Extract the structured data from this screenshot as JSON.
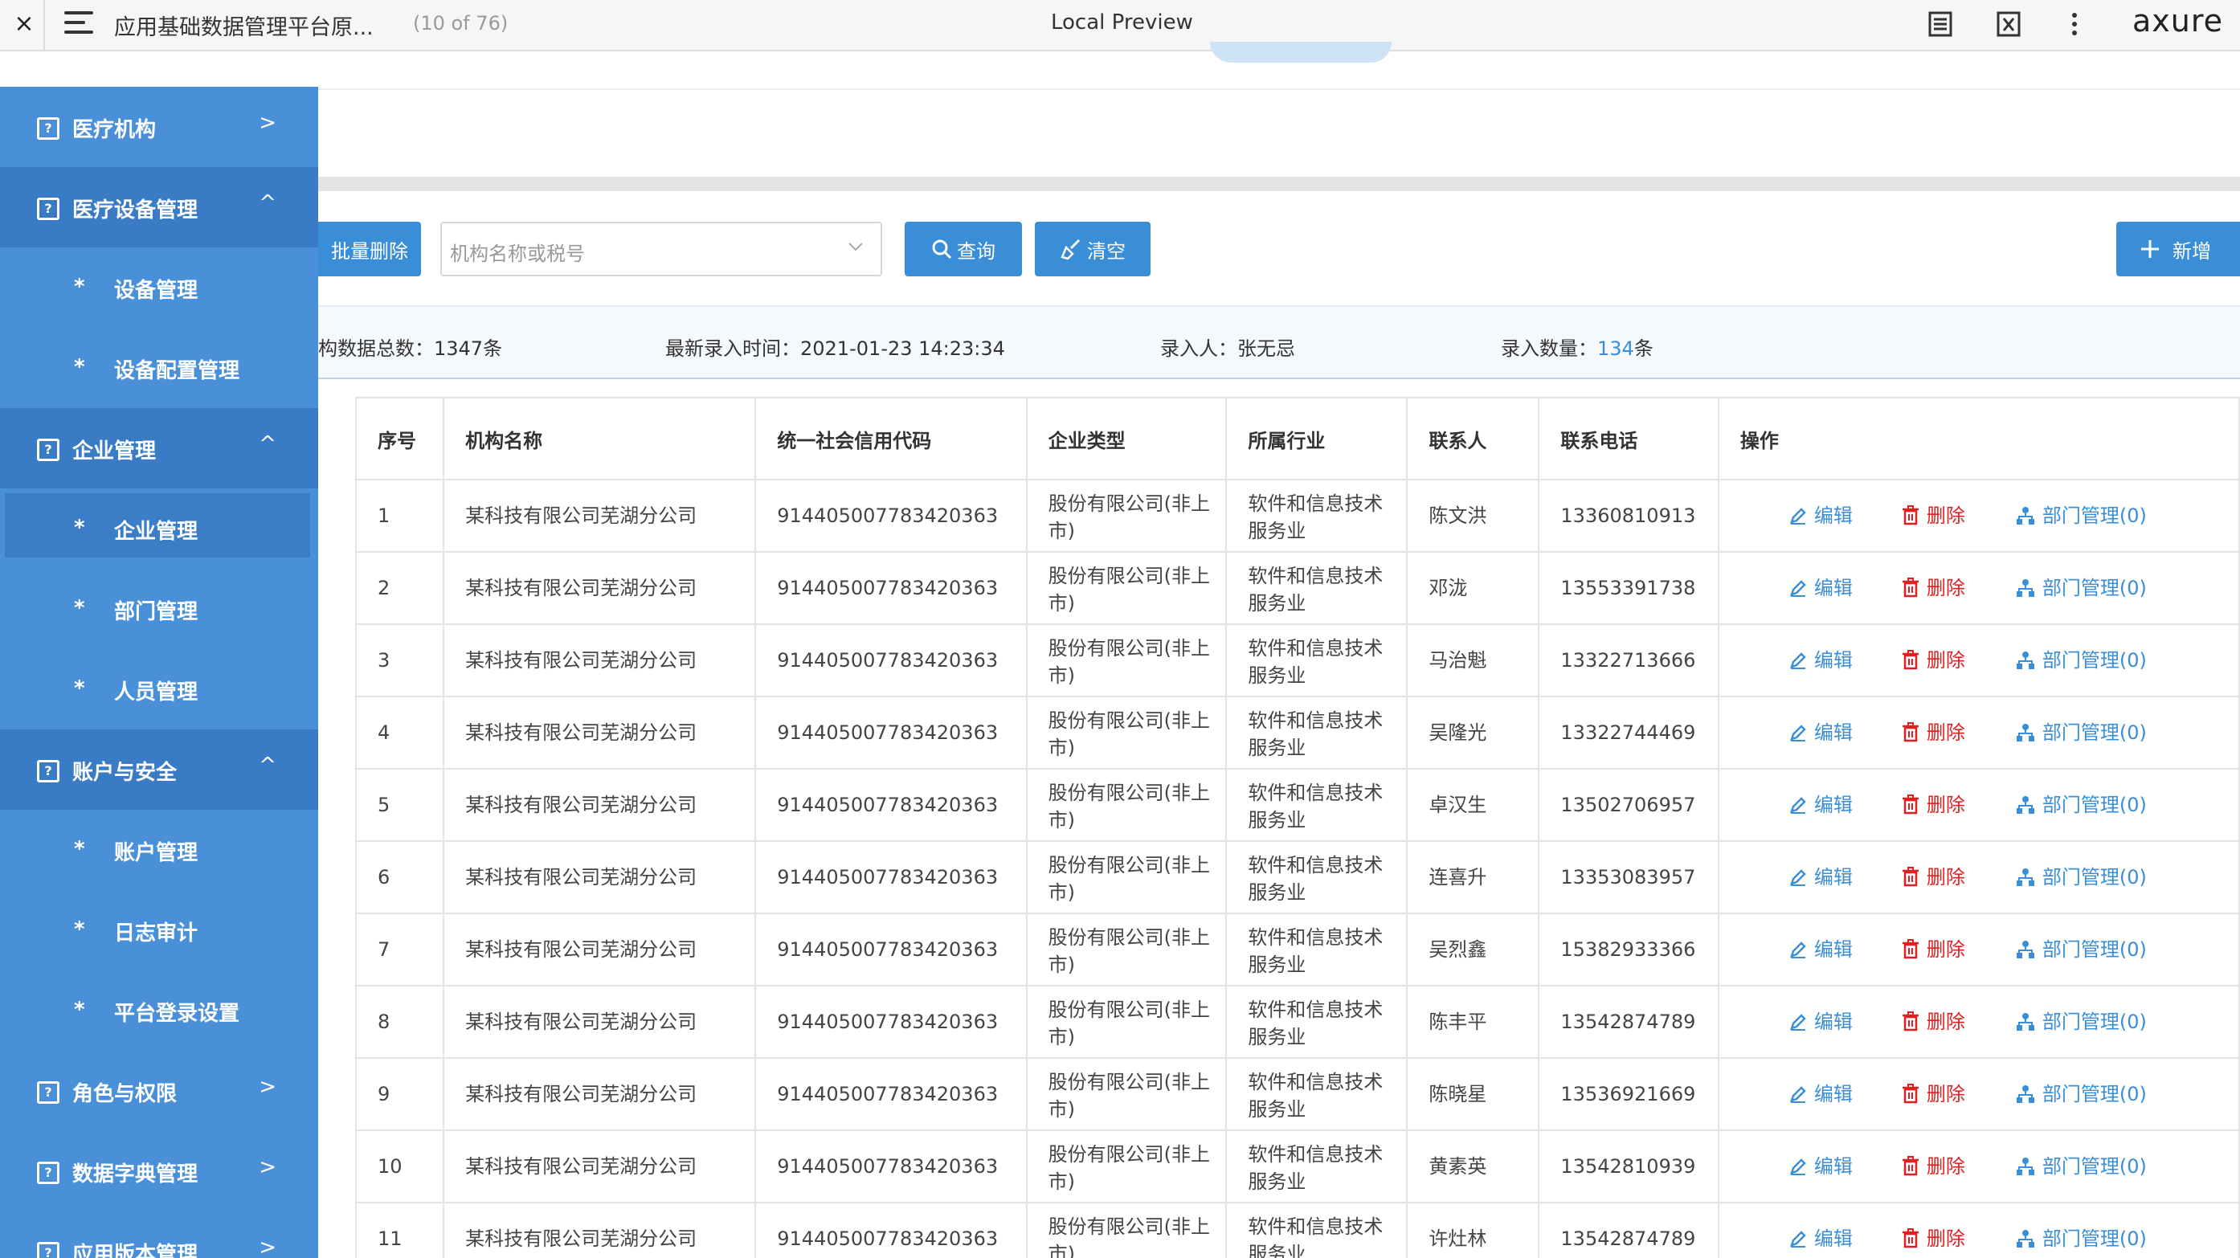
{
  "topbar": {
    "close": "×",
    "doc_title": "应用基础数据管理平台原...",
    "page_count": "(10 of 76)",
    "center_title": "Local Preview",
    "brand": "axure"
  },
  "sidebar": {
    "groups": [
      {
        "label": "医疗机构",
        "arrow": ">"
      },
      {
        "label": "医疗设备管理",
        "arrow": "^",
        "items": [
          {
            "label": "设备管理"
          },
          {
            "label": "设备配置管理"
          }
        ]
      },
      {
        "label": "企业管理",
        "arrow": "^",
        "items": [
          {
            "label": "企业管理"
          },
          {
            "label": "部门管理"
          },
          {
            "label": "人员管理"
          }
        ]
      },
      {
        "label": "账户与安全",
        "arrow": "^",
        "items": [
          {
            "label": "账户管理"
          },
          {
            "label": "日志审计"
          },
          {
            "label": "平台登录设置"
          }
        ]
      },
      {
        "label": "角色与权限",
        "arrow": ">"
      },
      {
        "label": "数据字典管理",
        "arrow": ">"
      },
      {
        "label": "应用版本管理",
        "arrow": ">"
      }
    ],
    "star": "*",
    "group_icon": "?"
  },
  "toolbar": {
    "batch_delete": "批量删除",
    "search_placeholder": "机构名称或税号",
    "query": "查询",
    "clear": "清空",
    "add": "新增"
  },
  "summary": {
    "total_label": "构数据总数：",
    "total_value": "1347条",
    "latest_label": "最新录入时间：",
    "latest_value": "2021-01-23 14:23:34",
    "entry_person_label": "录入人：",
    "entry_person_value": "张无忌",
    "entry_count_label": "录入数量：",
    "entry_count_value": "134",
    "entry_count_unit": "条"
  },
  "table": {
    "headers": [
      "序号",
      "机构名称",
      "统一社会信用代码",
      "企业类型",
      "所属行业",
      "联系人",
      "联系电话",
      "操作"
    ],
    "actions": {
      "edit": "编辑",
      "delete": "删除",
      "dept": "部门管理(0)"
    },
    "rows": [
      {
        "no": "1",
        "name": "某科技有限公司芜湖分公司",
        "code": "914405007783420363",
        "type1": "股份有限公司(非上",
        "type2": "市)",
        "ind1": "软件和信息技术",
        "ind2": "服务业",
        "contact": "陈文洪",
        "phone": "13360810913"
      },
      {
        "no": "2",
        "name": "某科技有限公司芜湖分公司",
        "code": "914405007783420363",
        "type1": "股份有限公司(非上",
        "type2": "市)",
        "ind1": "软件和信息技术",
        "ind2": "服务业",
        "contact": "邓泷",
        "phone": "13553391738"
      },
      {
        "no": "3",
        "name": "某科技有限公司芜湖分公司",
        "code": "914405007783420363",
        "type1": "股份有限公司(非上",
        "type2": "市)",
        "ind1": "软件和信息技术",
        "ind2": "服务业",
        "contact": "马治魁",
        "phone": "13322713666"
      },
      {
        "no": "4",
        "name": "某科技有限公司芜湖分公司",
        "code": "914405007783420363",
        "type1": "股份有限公司(非上",
        "type2": "市)",
        "ind1": "软件和信息技术",
        "ind2": "服务业",
        "contact": "吴隆光",
        "phone": "13322744469"
      },
      {
        "no": "5",
        "name": "某科技有限公司芜湖分公司",
        "code": "914405007783420363",
        "type1": "股份有限公司(非上",
        "type2": "市)",
        "ind1": "软件和信息技术",
        "ind2": "服务业",
        "contact": "卓汉生",
        "phone": "13502706957"
      },
      {
        "no": "6",
        "name": "某科技有限公司芜湖分公司",
        "code": "914405007783420363",
        "type1": "股份有限公司(非上",
        "type2": "市)",
        "ind1": "软件和信息技术",
        "ind2": "服务业",
        "contact": "连喜升",
        "phone": "13353083957"
      },
      {
        "no": "7",
        "name": "某科技有限公司芜湖分公司",
        "code": "914405007783420363",
        "type1": "股份有限公司(非上",
        "type2": "市)",
        "ind1": "软件和信息技术",
        "ind2": "服务业",
        "contact": "吴烈鑫",
        "phone": "15382933366"
      },
      {
        "no": "8",
        "name": "某科技有限公司芜湖分公司",
        "code": "914405007783420363",
        "type1": "股份有限公司(非上",
        "type2": "市)",
        "ind1": "软件和信息技术",
        "ind2": "服务业",
        "contact": "陈丰平",
        "phone": "13542874789"
      },
      {
        "no": "9",
        "name": "某科技有限公司芜湖分公司",
        "code": "914405007783420363",
        "type1": "股份有限公司(非上",
        "type2": "市)",
        "ind1": "软件和信息技术",
        "ind2": "服务业",
        "contact": "陈晓星",
        "phone": "13536921669"
      },
      {
        "no": "10",
        "name": "某科技有限公司芜湖分公司",
        "code": "914405007783420363",
        "type1": "股份有限公司(非上",
        "type2": "市)",
        "ind1": "软件和信息技术",
        "ind2": "服务业",
        "contact": "黄素英",
        "phone": "13542810939"
      },
      {
        "no": "11",
        "name": "某科技有限公司芜湖分公司",
        "code": "914405007783420363",
        "type1": "股份有限公司(非上",
        "type2": "市)",
        "ind1": "软件和信息技术",
        "ind2": "服务业",
        "contact": "许灶林",
        "phone": "13542874789"
      }
    ]
  },
  "colors": {
    "sidebar": "#4a90d9",
    "sidebar_open": "#3a7bc6",
    "primary": "#3a8ed7",
    "danger": "#e02020"
  }
}
